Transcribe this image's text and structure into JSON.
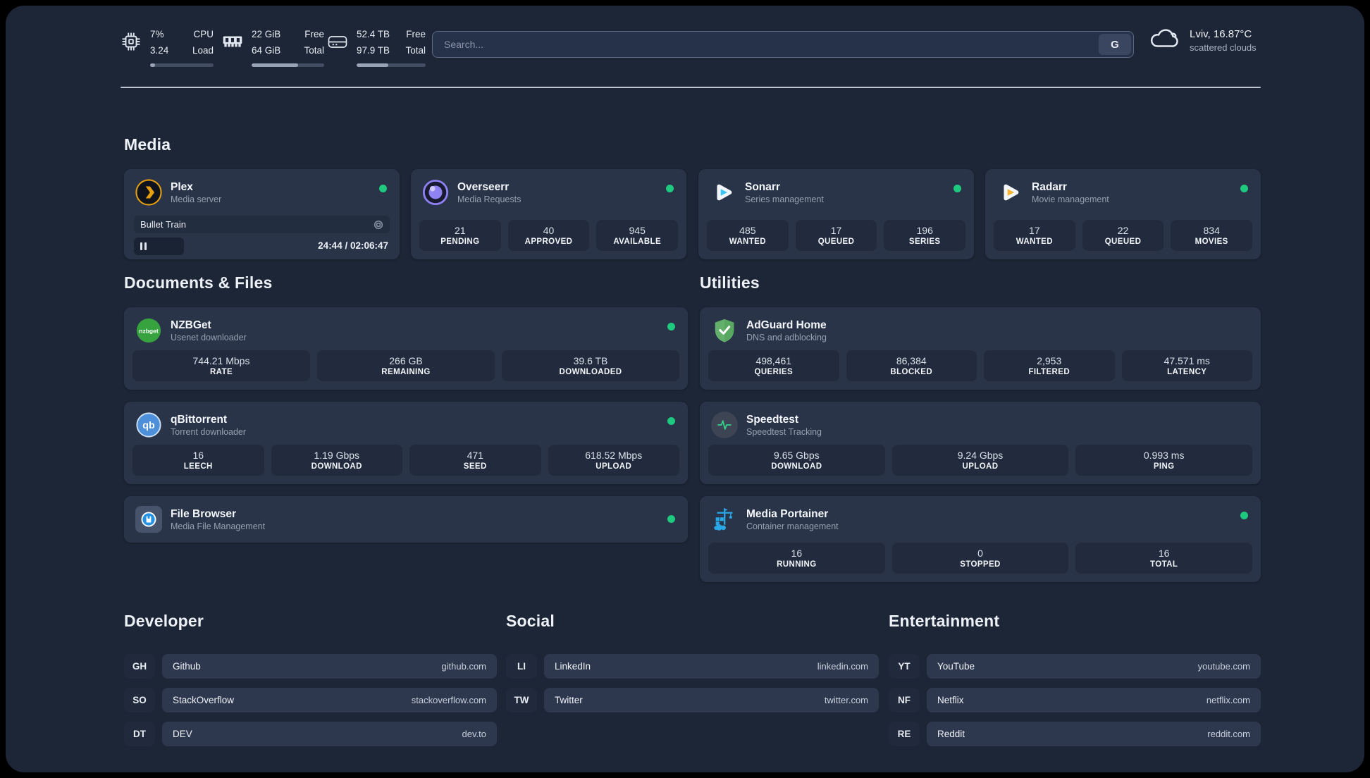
{
  "colors": {
    "status_online": "#1ec980",
    "accent_plex": "#e5a00d",
    "accent_sonarr": "#3bc5f4",
    "accent_radarr": "#f7b52c",
    "accent_portainer": "#2aa7e5"
  },
  "header": {
    "system_stats": [
      {
        "value_line1": "7%",
        "label_line1": "CPU",
        "value_line2": "3.24",
        "label_line2": "Load",
        "progress_percent": 8
      },
      {
        "value_line1": "22 GiB",
        "label_line1": "Free",
        "value_line2": "64 GiB",
        "label_line2": "Total",
        "progress_percent": 64
      },
      {
        "value_line1": "52.4 TB",
        "label_line1": "Free",
        "value_line2": "97.9 TB",
        "label_line2": "Total",
        "progress_percent": 46
      }
    ],
    "search": {
      "placeholder": "Search...",
      "provider_button_label": "G"
    },
    "weather": {
      "location_temperature": "Lviv, 16.87°C",
      "condition": "scattered clouds"
    }
  },
  "media": {
    "title": "Media",
    "plex": {
      "name": "Plex",
      "subtitle": "Media server",
      "now_playing_title": "Bullet Train",
      "time_display": "24:44 / 02:06:47",
      "progress_percent": 19.5,
      "state": "paused"
    },
    "overseerr": {
      "name": "Overseerr",
      "subtitle": "Media Requests",
      "stats": [
        {
          "value": "21",
          "label": "PENDING"
        },
        {
          "value": "40",
          "label": "APPROVED"
        },
        {
          "value": "945",
          "label": "AVAILABLE"
        }
      ]
    },
    "sonarr": {
      "name": "Sonarr",
      "subtitle": "Series management",
      "stats": [
        {
          "value": "485",
          "label": "WANTED"
        },
        {
          "value": "17",
          "label": "QUEUED"
        },
        {
          "value": "196",
          "label": "SERIES"
        }
      ]
    },
    "radarr": {
      "name": "Radarr",
      "subtitle": "Movie management",
      "stats": [
        {
          "value": "17",
          "label": "WANTED"
        },
        {
          "value": "22",
          "label": "QUEUED"
        },
        {
          "value": "834",
          "label": "MOVIES"
        }
      ]
    }
  },
  "documents": {
    "title": "Documents & Files",
    "nzbget": {
      "name": "NZBGet",
      "subtitle": "Usenet downloader",
      "icon_text": "nzbget",
      "stats": [
        {
          "value": "744.21 Mbps",
          "label": "RATE"
        },
        {
          "value": "266 GB",
          "label": "REMAINING"
        },
        {
          "value": "39.6 TB",
          "label": "DOWNLOADED"
        }
      ]
    },
    "qbittorrent": {
      "name": "qBittorrent",
      "subtitle": "Torrent downloader",
      "icon_text": "qb",
      "stats": [
        {
          "value": "16",
          "label": "LEECH"
        },
        {
          "value": "1.19 Gbps",
          "label": "DOWNLOAD"
        },
        {
          "value": "471",
          "label": "SEED"
        },
        {
          "value": "618.52 Mbps",
          "label": "UPLOAD"
        }
      ]
    },
    "filebrowser": {
      "name": "File Browser",
      "subtitle": "Media File Management"
    }
  },
  "utilities": {
    "title": "Utilities",
    "adguard": {
      "name": "AdGuard Home",
      "subtitle": "DNS and adblocking",
      "stats": [
        {
          "value": "498,461",
          "label": "QUERIES"
        },
        {
          "value": "86,384",
          "label": "BLOCKED"
        },
        {
          "value": "2,953",
          "label": "FILTERED"
        },
        {
          "value": "47.571 ms",
          "label": "LATENCY"
        }
      ]
    },
    "speedtest": {
      "name": "Speedtest",
      "subtitle": "Speedtest Tracking",
      "stats": [
        {
          "value": "9.65 Gbps",
          "label": "DOWNLOAD"
        },
        {
          "value": "9.24 Gbps",
          "label": "UPLOAD"
        },
        {
          "value": "0.993 ms",
          "label": "PING"
        }
      ]
    },
    "portainer": {
      "name": "Media Portainer",
      "subtitle": "Container management",
      "stats": [
        {
          "value": "16",
          "label": "RUNNING"
        },
        {
          "value": "0",
          "label": "STOPPED"
        },
        {
          "value": "16",
          "label": "TOTAL"
        }
      ]
    }
  },
  "links": {
    "developer": {
      "title": "Developer",
      "items": [
        {
          "abbr": "GH",
          "name": "Github",
          "url": "github.com"
        },
        {
          "abbr": "SO",
          "name": "StackOverflow",
          "url": "stackoverflow.com"
        },
        {
          "abbr": "DT",
          "name": "DEV",
          "url": "dev.to"
        }
      ]
    },
    "social": {
      "title": "Social",
      "items": [
        {
          "abbr": "LI",
          "name": "LinkedIn",
          "url": "linkedin.com"
        },
        {
          "abbr": "TW",
          "name": "Twitter",
          "url": "twitter.com"
        }
      ]
    },
    "entertainment": {
      "title": "Entertainment",
      "items": [
        {
          "abbr": "YT",
          "name": "YouTube",
          "url": "youtube.com"
        },
        {
          "abbr": "NF",
          "name": "Netflix",
          "url": "netflix.com"
        },
        {
          "abbr": "RE",
          "name": "Reddit",
          "url": "reddit.com"
        }
      ]
    }
  }
}
